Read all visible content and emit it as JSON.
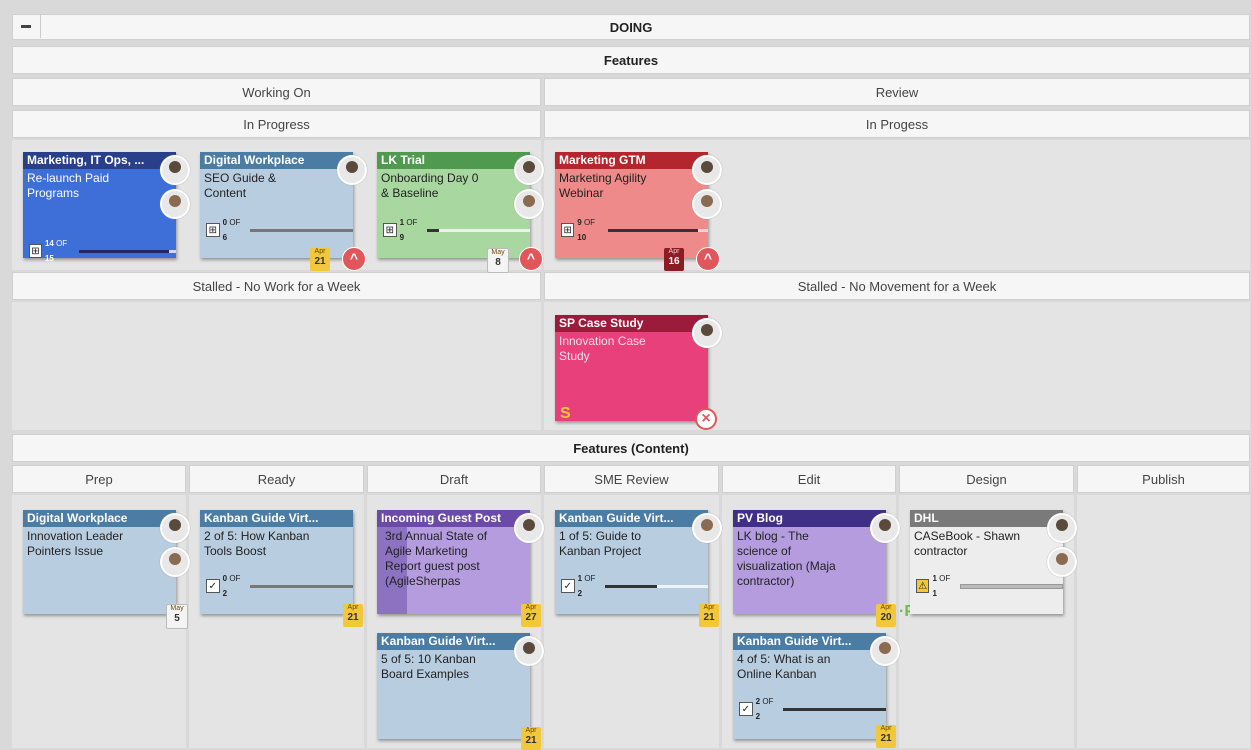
{
  "board": {
    "title": "DOING",
    "section1": "Features",
    "working_on": "Working On",
    "review": "Review",
    "in_progress": "In Progress",
    "in_progess": "In Progess",
    "stalled_work": "Stalled - No Work for a Week",
    "stalled_movement": "Stalled - No Movement for a Week",
    "section2": "Features (Content)",
    "columns": [
      "Prep",
      "Ready",
      "Draft",
      "SME Review",
      "Edit",
      "Design",
      "Publish"
    ]
  },
  "cards": {
    "c1": {
      "header": "Marketing, IT Ops, ...",
      "body": "Re-launch Paid\nPrograms",
      "prog_done": "14",
      "prog_of": "OF",
      "prog_total": "15",
      "progress": 0.93,
      "color": "#3e6fd8",
      "hcolor": "#2a3f8a"
    },
    "c2": {
      "header": "Digital Workplace",
      "body": "SEO Guide &\nContent",
      "prog_done": "0",
      "prog_of": "OF",
      "prog_total": "6",
      "progress": 0,
      "date_m": "Apr",
      "date_d": "21",
      "alert": "^"
    },
    "c3": {
      "header": "LK Trial",
      "body": "Onboarding Day 0\n& Baseline",
      "prog_done": "1",
      "prog_of": "OF",
      "prog_total": "9",
      "progress": 0.11,
      "date_m": "May",
      "date_d": "8",
      "alert": "^"
    },
    "c4": {
      "header": "Marketing GTM",
      "body": "Marketing Agility\nWebinar",
      "prog_done": "9",
      "prog_of": "OF",
      "prog_total": "10",
      "progress": 0.9,
      "date_m": "Apr",
      "date_d": "16",
      "alert": "^"
    },
    "c5": {
      "header": "SP Case Study",
      "body": "Innovation Case\nStudy",
      "badge": "S",
      "close": "×"
    },
    "c6": {
      "header": "Digital Workplace",
      "body": "Innovation Leader\nPointers Issue",
      "date_m": "May",
      "date_d": "5"
    },
    "c7": {
      "header": "Kanban Guide Virt...",
      "body": "2 of 5: How Kanban\nTools Boost",
      "prog_done": "0",
      "prog_of": "OF",
      "prog_total": "2",
      "progress": 0,
      "date_m": "Apr",
      "date_d": "21"
    },
    "c8": {
      "header": "Incoming Guest Post",
      "body": "3rd Annual State of\nAgile Marketing\nReport guest post\n(AgileSherpas",
      "date_m": "Apr",
      "date_d": "27"
    },
    "c9": {
      "header": "Kanban Guide Virt...",
      "body": "5 of 5: 10 Kanban\nBoard Examples",
      "date_m": "Apr",
      "date_d": "21"
    },
    "c10": {
      "header": "Kanban Guide Virt...",
      "body": "1 of 5: Guide to\nKanban Project",
      "prog_done": "1",
      "prog_of": "OF",
      "prog_total": "2",
      "progress": 0.5,
      "date_m": "Apr",
      "date_d": "21"
    },
    "c11": {
      "header": "PV Blog",
      "body": "LK blog - The\nscience of\nvisualization (Maja\ncontractor)",
      "date_m": "Apr",
      "date_d": "20",
      "badge": "P"
    },
    "c12": {
      "header": "Kanban Guide Virt...",
      "body": "4 of 5: What is an\nOnline Kanban",
      "prog_done": "2",
      "prog_of": "OF",
      "prog_total": "2",
      "progress": 1,
      "date_m": "Apr",
      "date_d": "21"
    },
    "c13": {
      "header": "DHL",
      "body": "CASeBook - Shawn\ncontractor",
      "prog_done": "1",
      "prog_of": "OF",
      "prog_total": "1",
      "progress": 1
    }
  },
  "icons": {
    "collapse": "minus-icon",
    "checkbox": "checkbox-icon",
    "tree": "tree-icon",
    "warning": "warning-icon",
    "blocker": "blocker-icon"
  },
  "colors": {
    "blue_card": "#b8cde0",
    "blue_head": "#4b7ca3",
    "green_card": "#a8d8a0",
    "green_head": "#4f9a4f",
    "red_card": "#ef8a8a",
    "red_head": "#b3262e",
    "pink_card": "#e8407a",
    "pink_head": "#9c1b3a",
    "purple_card": "#b49cde",
    "purple_head": "#6b4aa8",
    "dark_purple_head": "#3f2f85",
    "grey_head": "#7a7a7a",
    "grey_card": "#ededed"
  }
}
